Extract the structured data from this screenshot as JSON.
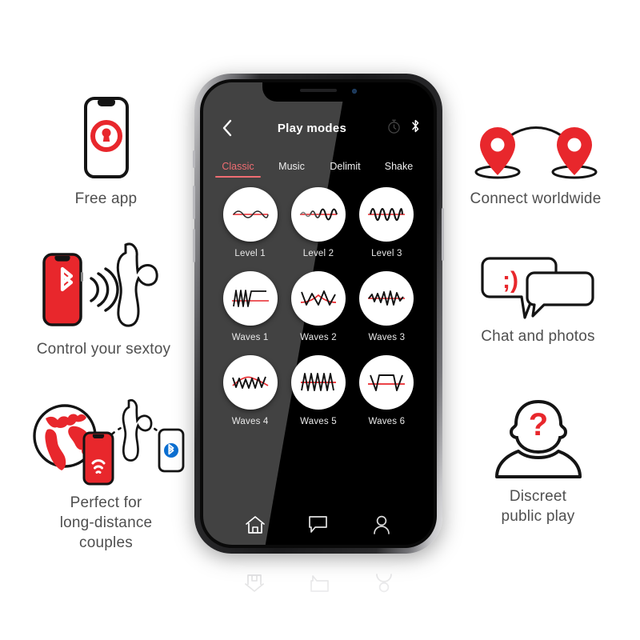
{
  "brand": {
    "red": "#E8272C",
    "accent_pink": "#EF6D72",
    "dark": "#000000",
    "text_gray": "#4F4F4F"
  },
  "phone_app": {
    "header": {
      "back_icon": "chevron-left-icon",
      "title": "Play modes",
      "timer_icon": "stopwatch-icon",
      "bluetooth_icon": "bluetooth-icon"
    },
    "tabs": [
      {
        "label": "Classic",
        "active": true
      },
      {
        "label": "Music",
        "active": false
      },
      {
        "label": "Delimit",
        "active": false
      },
      {
        "label": "Shake",
        "active": false
      }
    ],
    "modes": [
      {
        "label": "Level 1",
        "wave": "sine-low-amplitude"
      },
      {
        "label": "Level 2",
        "wave": "sine-ramping-amplitude"
      },
      {
        "label": "Level 3",
        "wave": "sine-high-frequency"
      },
      {
        "label": "Waves 1",
        "wave": "burst-then-hold"
      },
      {
        "label": "Waves 2",
        "wave": "wide-triangle-peak"
      },
      {
        "label": "Waves 3",
        "wave": "small-then-large-zigzag"
      },
      {
        "label": "Waves 4",
        "wave": "zigzag-with-arc"
      },
      {
        "label": "Waves 5",
        "wave": "dense-triangle-ramp"
      },
      {
        "label": "Waves 6",
        "wave": "square-pulse"
      }
    ],
    "navbar": [
      {
        "icon": "home-icon",
        "label": "Home",
        "active": true
      },
      {
        "icon": "chat-bubble-icon",
        "label": "Chat",
        "active": false
      },
      {
        "icon": "profile-icon",
        "label": "Profile",
        "active": false
      }
    ]
  },
  "features_left": [
    {
      "id": "free-app",
      "icon": "phone-lock-icon",
      "caption": "Free app"
    },
    {
      "id": "control-sextoy",
      "icon": "phone-bluetooth-toy-icon",
      "caption": "Control your sextoy"
    },
    {
      "id": "long-distance",
      "icon": "globe-phone-toy-icon",
      "caption": "Perfect for\nlong-distance\ncouples"
    }
  ],
  "features_right": [
    {
      "id": "connect-worldwide",
      "icon": "two-map-pins-icon",
      "caption": "Connect worldwide"
    },
    {
      "id": "chat-photos",
      "icon": "two-speech-bubbles-icon",
      "caption": "Chat and photos",
      "emoticon": ";)"
    },
    {
      "id": "discreet-play",
      "icon": "anonymous-person-icon",
      "caption": "Discreet\npublic play",
      "symbol": "?"
    }
  ]
}
